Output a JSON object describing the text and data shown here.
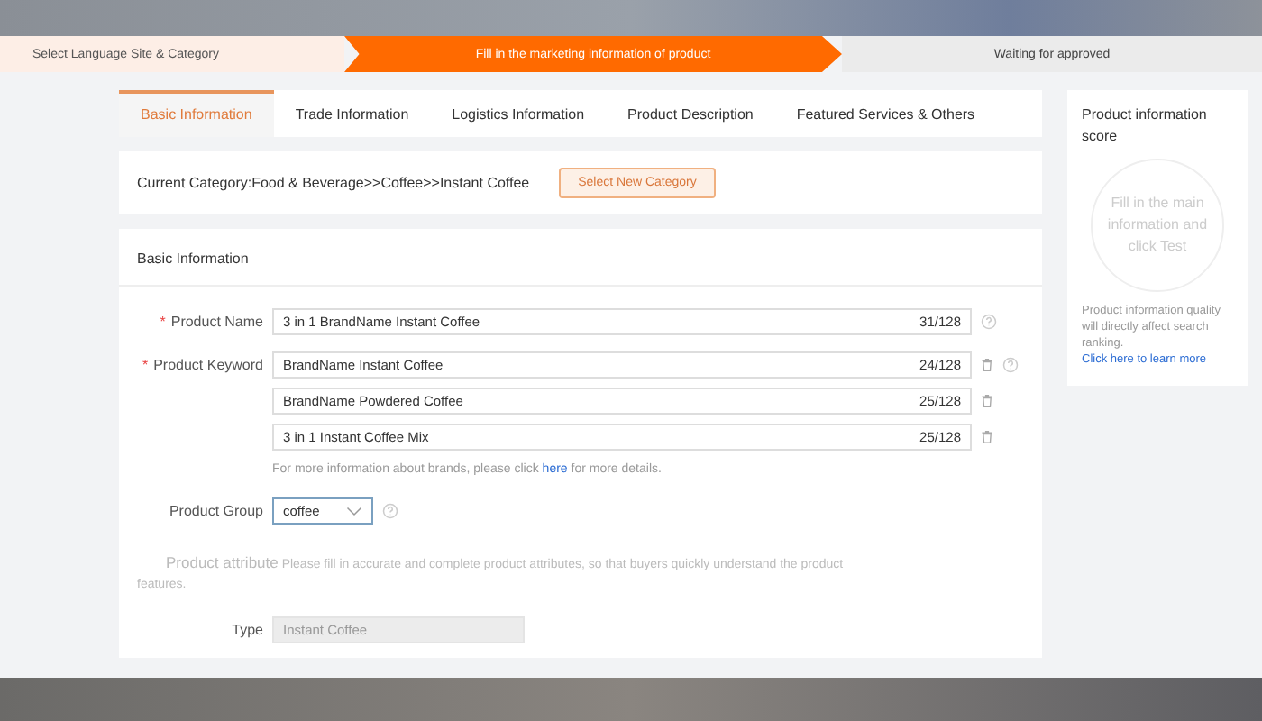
{
  "steps": [
    {
      "label": "Select Language Site & Category",
      "completed": true,
      "selected": false
    },
    {
      "label": "Fill in the marketing information of product",
      "completed": false,
      "selected": true
    },
    {
      "label": "Waiting for approved",
      "completed": false,
      "selected": false
    }
  ],
  "tabs": [
    {
      "label": "Basic Information",
      "selected": true
    },
    {
      "label": "Trade Information",
      "selected": false
    },
    {
      "label": "Logistics Information",
      "selected": false
    },
    {
      "label": "Product Description",
      "selected": false
    },
    {
      "label": "Featured Services & Others",
      "selected": false
    }
  ],
  "category": {
    "text": "Current Category:Food & Beverage>>Coffee>>Instant Coffee",
    "button": "Select New Category"
  },
  "section_title": "Basic Information",
  "product_name": {
    "label": "Product Name",
    "required_mark": "*",
    "value": "3 in 1 BrandName Instant Coffee",
    "count": "31/128"
  },
  "product_keyword": {
    "label": "Product Keyword",
    "required_mark": "*",
    "values": [
      {
        "value": "BrandName Instant Coffee",
        "count": "24/128"
      },
      {
        "value": "BrandName Powdered Coffee",
        "count": "25/128"
      },
      {
        "value": "3 in 1 Instant Coffee Mix",
        "count": "25/128"
      }
    ],
    "note": {
      "before": "For more information about brands, please click ",
      "link": "here",
      "after": " for more details."
    }
  },
  "product_group": {
    "label": "Product Group",
    "value": "coffee"
  },
  "product_attribute": {
    "title": "Product attribute",
    "description": "Please fill in accurate and complete product attributes, so that buyers quickly understand the product features."
  },
  "type_field": {
    "label": "Type",
    "placeholder": "Instant Coffee",
    "disabled": true
  },
  "score_panel": {
    "title": "Product information score",
    "circle_text": "Fill in the main information and click Test",
    "note": "Product information quality will directly affect search ranking.",
    "link": "Click here to learn more"
  }
}
